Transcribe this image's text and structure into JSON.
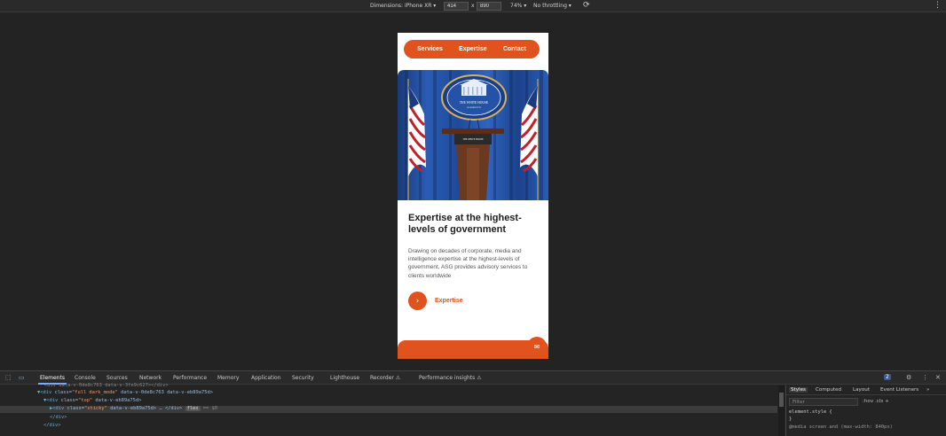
{
  "device_toolbar": {
    "dimensions_label": "Dimensions: iPhone XR ▾",
    "width": "414",
    "times": "x",
    "height": "890",
    "zoom": "74% ▾",
    "throttling": "No throttling ▾",
    "rotate_icon": "rotate-icon",
    "more_icon": "⋮"
  },
  "site": {
    "nav": [
      "Services",
      "Expertise",
      "Contact"
    ],
    "headline": "Expertise at the highest-levels of government",
    "body": "Drawing on decades of corporate, media and intelligence expertise at the highest-levels of government, ASG provides advisory services to clients worldwide",
    "cta_label": "Expertise",
    "cta_icon": "›",
    "chat_icon": "✉",
    "accent": "#e0521e",
    "hero_seal_text": "THE WHITE HOUSE",
    "hero_seal_sub": "WASHINGTON",
    "podium_sign": "THE WHITE HOUSE"
  },
  "devtools": {
    "tabs": [
      "Elements",
      "Console",
      "Sources",
      "Network",
      "Performance",
      "Memory",
      "Application",
      "Security",
      "Lighthouse",
      "Recorder ⚠",
      "Performance insights ⚠"
    ],
    "active_tab": "Elements",
    "issues_badge": "2",
    "elements_lines": [
      {
        "prefix": "<div data-v-0de8c763 data-v-3fe9c627>",
        "suffix": "</div>"
      },
      {
        "tag_open": "▼<div",
        "attr1": " class=",
        "val1": "\"full dark_mode\"",
        "rest": " data-v-0de8c763 data-v-eb89a75d>"
      },
      {
        "tag_open": "▼<div",
        "attr1": " class=",
        "val1": "\"top\"",
        "rest": " data-v-eb89a75d>"
      },
      {
        "tag_open": "▶<div",
        "attr1": " class=",
        "val1": "\"sticky\"",
        "rest": " data-v-eb89a75d> … </div>",
        "badge": "flex",
        "eq": " == $0"
      },
      {
        "text": "</div>"
      },
      {
        "text": "</div>"
      }
    ],
    "styles_tabs": [
      "Styles",
      "Computed",
      "Layout",
      "Event Listeners",
      "»"
    ],
    "filter_placeholder": "Filter",
    "filter_opts": ":hov  .cls  +",
    "style_lines": [
      "element.style {",
      "}",
      "@media screen and (max-width: 840px)"
    ]
  }
}
